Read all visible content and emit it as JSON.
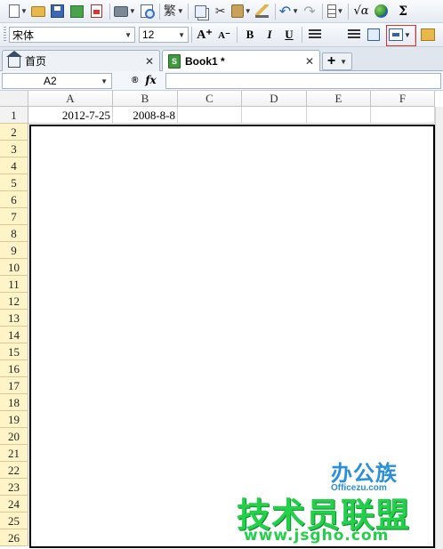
{
  "toolbar": {
    "traditional_chinese_label": "繁",
    "font_name": "宋体",
    "font_size": "12",
    "bold_label": "B",
    "italic_label": "I",
    "underline_label": "U",
    "sqrt_label": "√α",
    "sigma_label": "Σ",
    "increase_font_label": "A⁺",
    "decrease_font_label": "A⁻"
  },
  "tabs": [
    {
      "label": "首页",
      "active": false
    },
    {
      "label": "Book1 *",
      "active": true
    }
  ],
  "newtab_label": "+",
  "formula_bar": {
    "cell_name": "A2",
    "zoom_label": "®",
    "fx_label": "fx",
    "formula": ""
  },
  "sheet": {
    "columns": [
      "A",
      "B",
      "C",
      "D",
      "E",
      "F"
    ],
    "rows": [
      "1",
      "2",
      "3",
      "4",
      "5",
      "6",
      "7",
      "8",
      "9",
      "10",
      "11",
      "12",
      "13",
      "14",
      "15",
      "16",
      "17",
      "18",
      "19",
      "20",
      "21",
      "22",
      "23",
      "24",
      "25",
      "26"
    ],
    "cells": {
      "A1": "2012-7-25",
      "B1": "2008-8-8"
    }
  },
  "watermark": {
    "brand": "办公族",
    "brand_sub": "Officezu.com",
    "main": "技术员联盟",
    "url": "www.jsgho.com"
  }
}
